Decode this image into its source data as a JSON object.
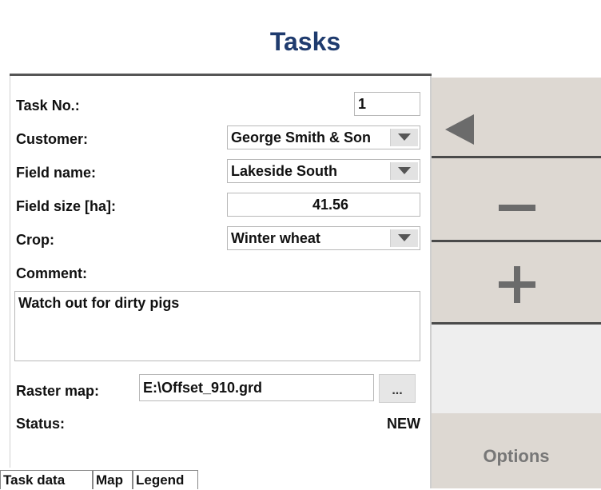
{
  "header": {
    "title": "Tasks"
  },
  "form": {
    "task_no": {
      "label": "Task No.:",
      "value": "1"
    },
    "customer": {
      "label": "Customer:",
      "value": "George Smith & Son"
    },
    "field_name": {
      "label": "Field name:",
      "value": "Lakeside South"
    },
    "field_size": {
      "label": "Field size [ha]:",
      "value": "41.56"
    },
    "crop": {
      "label": "Crop:",
      "value": "Winter wheat"
    },
    "comment": {
      "label": "Comment:",
      "value": "Watch out for dirty pigs"
    },
    "raster_map": {
      "label": "Raster map:",
      "value": "E:\\Offset_910.grd",
      "browse_label": "..."
    },
    "status": {
      "label": "Status:",
      "value": "NEW"
    }
  },
  "tabs": [
    {
      "label": "Task data"
    },
    {
      "label": "Map"
    },
    {
      "label": "Legend"
    }
  ],
  "sidebar": {
    "back_icon": "triangle-left-icon",
    "minus_icon": "minus-icon",
    "plus_icon": "plus-icon",
    "options_label": "Options"
  },
  "colors": {
    "title": "#1f3b6e",
    "side_button": "#ddd8d2",
    "side_icon": "#6b6b6b",
    "options_disabled_text": "#777777"
  }
}
